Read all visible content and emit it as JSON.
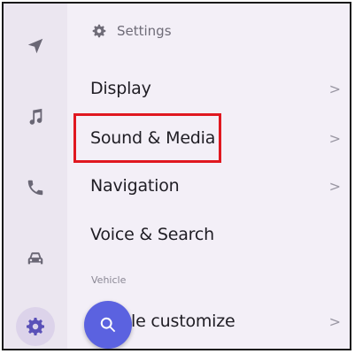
{
  "header": {
    "title": "Settings",
    "icon": "gear-icon"
  },
  "rail": {
    "items": [
      {
        "icon": "navigation-arrow-icon",
        "active": false
      },
      {
        "icon": "music-note-icon",
        "active": false
      },
      {
        "icon": "phone-icon",
        "active": false
      },
      {
        "icon": "car-icon",
        "active": false
      },
      {
        "icon": "gear-icon",
        "active": true
      }
    ]
  },
  "menu": {
    "items": [
      {
        "label": "Display",
        "has_chevron": true
      },
      {
        "label": "Sound & Media",
        "has_chevron": true,
        "highlighted": true
      },
      {
        "label": "Navigation",
        "has_chevron": true
      },
      {
        "label": "Voice & Search",
        "has_chevron": false
      }
    ],
    "section_label": "Vehicle",
    "partial_item": {
      "label": "le customize",
      "has_chevron": true
    }
  },
  "chevron_glyph": ">",
  "search_fab": {
    "icon": "search-icon"
  },
  "colors": {
    "background": "#f3eff7",
    "rail": "#ebe6f0",
    "highlight_border": "#e01820",
    "fab": "#5b62e0",
    "active_icon": "#5a50b8"
  }
}
